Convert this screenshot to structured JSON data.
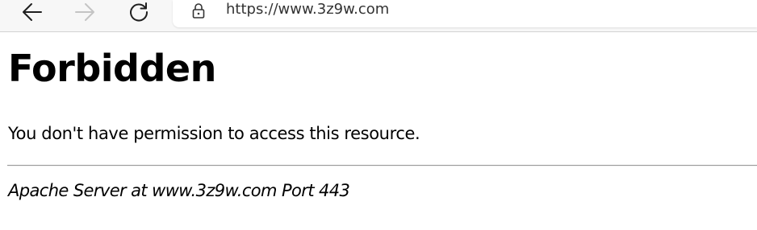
{
  "browser": {
    "url": "https://www.3z9w.com",
    "back_icon": "arrow-left-icon",
    "forward_icon": "arrow-right-icon",
    "refresh_icon": "refresh-icon",
    "lock_icon": "lock-icon",
    "forward_enabled": false
  },
  "page": {
    "title": "Forbidden",
    "message": "You don't have permission to access this resource.",
    "signature": "Apache Server at www.3z9w.com Port 443"
  },
  "colors": {
    "icon_active": "#1f1f1f",
    "icon_disabled": "#c4c4c4",
    "url_text": "#333333",
    "rule": "#9a9a9a"
  }
}
